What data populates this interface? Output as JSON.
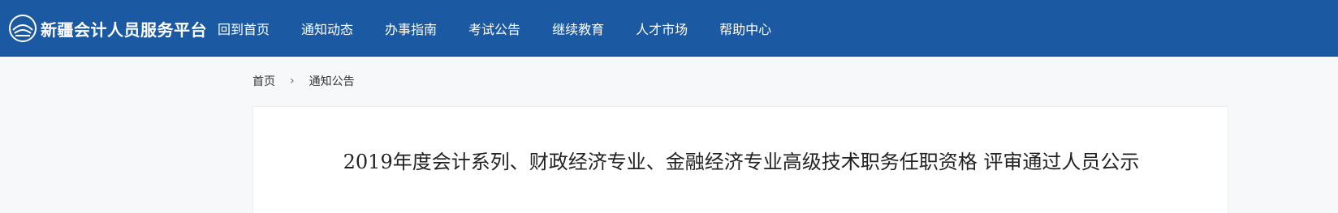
{
  "header": {
    "brand_name": "新疆会计人员服务平台",
    "logo_icon": "emblem-icon",
    "colors": {
      "bar": "#1b5aa3",
      "text": "#ffffff"
    }
  },
  "nav": {
    "items": [
      {
        "label": "回到首页"
      },
      {
        "label": "通知动态"
      },
      {
        "label": "办事指南"
      },
      {
        "label": "考试公告"
      },
      {
        "label": "继续教育"
      },
      {
        "label": "人才市场"
      },
      {
        "label": "帮助中心"
      }
    ]
  },
  "breadcrumb": {
    "home": "首页",
    "separator": "›",
    "current": "通知公告"
  },
  "article": {
    "title": "2019年度会计系列、财政经济专业、金融经济专业高级技术职务任职资格 评审通过人员公示"
  }
}
